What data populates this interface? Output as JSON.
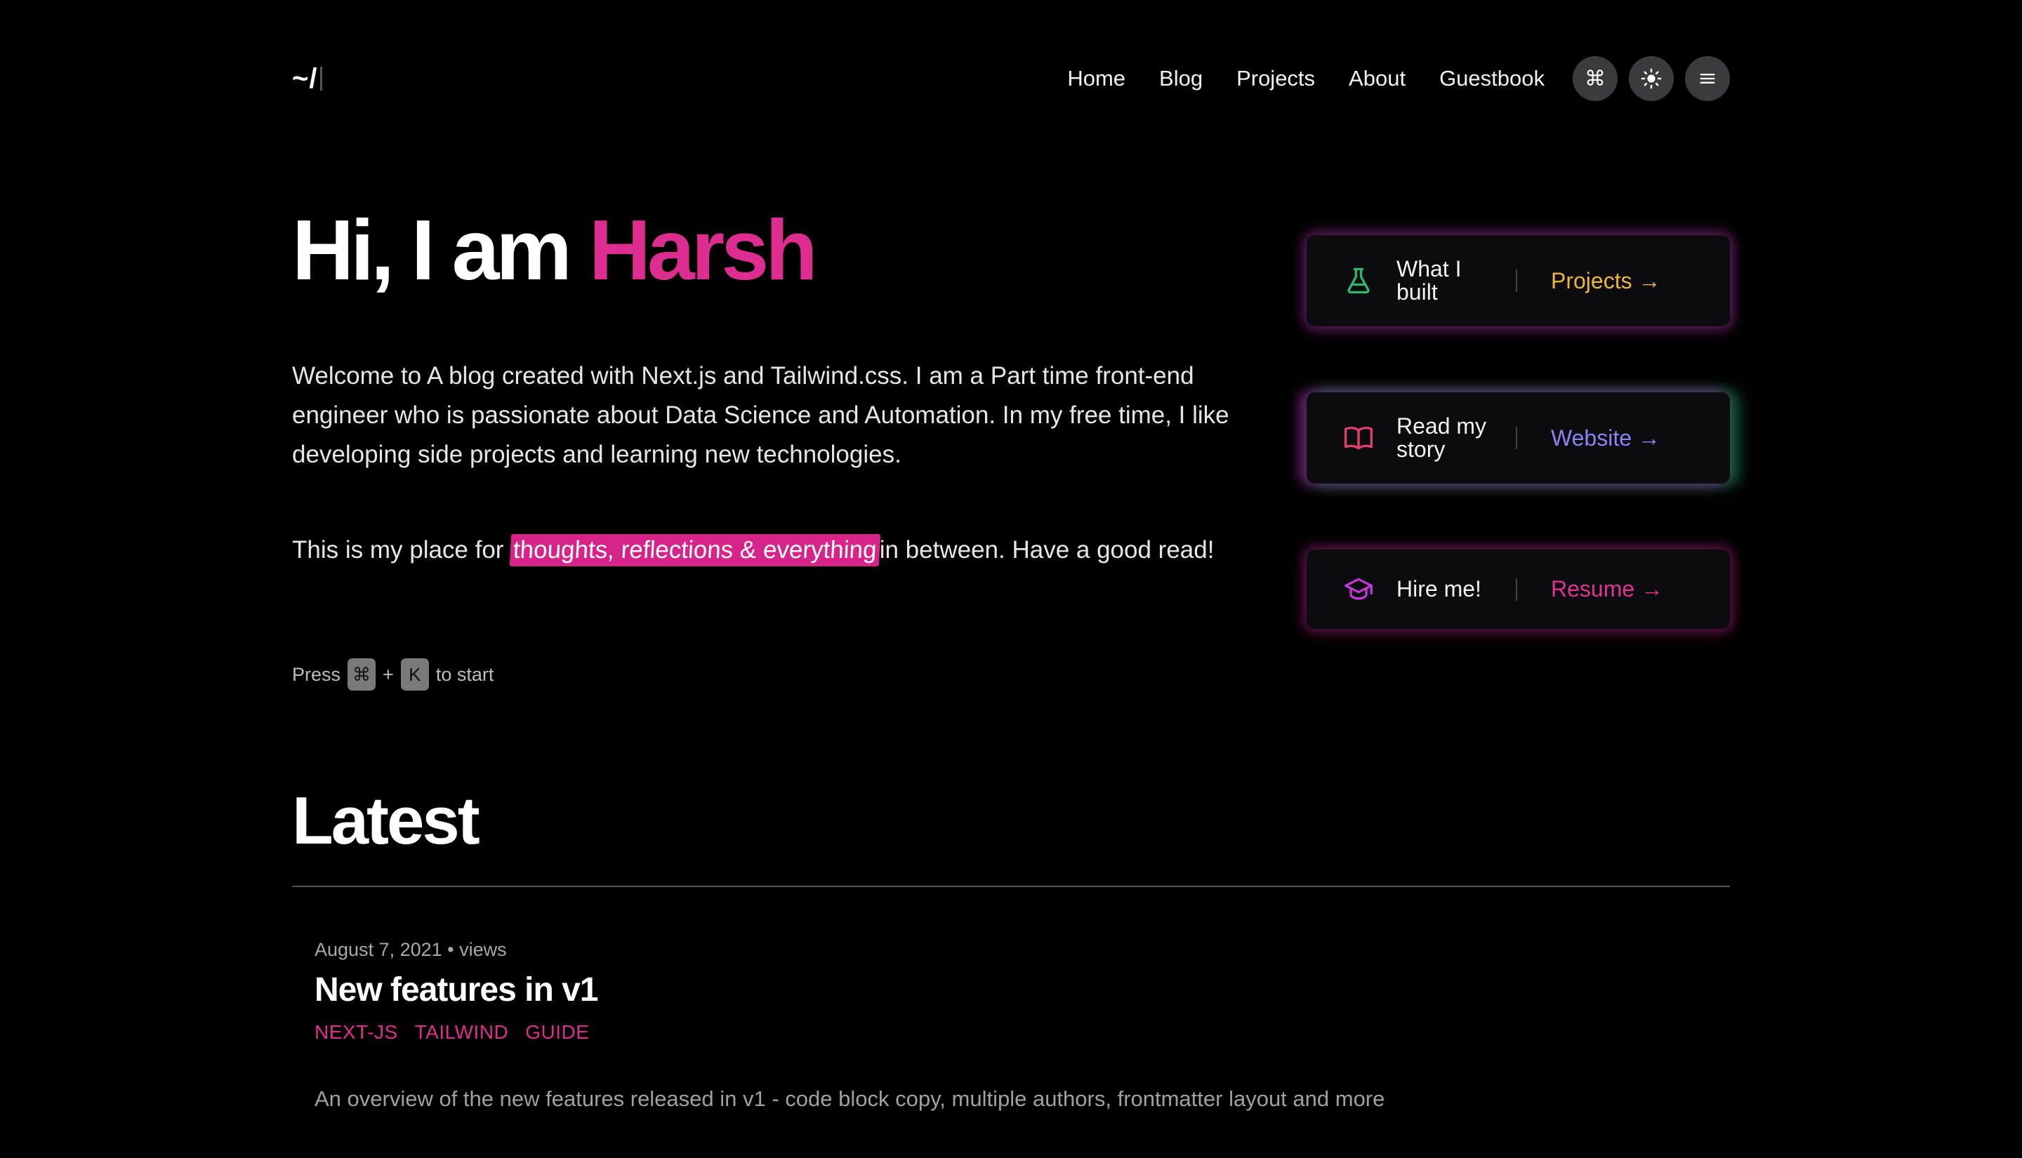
{
  "header": {
    "logo": "~/",
    "nav": [
      "Home",
      "Blog",
      "Projects",
      "About",
      "Guestbook"
    ],
    "buttons": [
      {
        "icon": "command-icon",
        "glyph": "⌘"
      },
      {
        "icon": "sun-icon",
        "glyph": "☀"
      },
      {
        "icon": "menu-icon",
        "glyph": "≡"
      }
    ]
  },
  "hero": {
    "greeting": "Hi, I am ",
    "name": "Harsh",
    "intro": "Welcome to A blog created with Next.js and Tailwind.css. I am a Part time front-end engineer who is passionate about Data Science and Automation. In my free time, I like developing side projects and learning new technologies.",
    "tagline_before": "This is my place for ",
    "tagline_highlight": "thoughts, reflections & everything ",
    "tagline_after": "in between. Have a good read!",
    "press_prefix": "Press",
    "key1": "⌘",
    "plus": "+",
    "key2": "K",
    "press_suffix": "to start"
  },
  "cards": [
    {
      "label": "What I built",
      "link": "Projects →",
      "icon": "flask-icon",
      "color": "#2eb872"
    },
    {
      "label": "Read my story",
      "link": "Website →",
      "icon": "book-icon",
      "color": "#e0406a"
    },
    {
      "label": "Hire me!",
      "link": "Resume →",
      "icon": "graduation-cap-icon",
      "color": "#c23ad6"
    }
  ],
  "latest": {
    "title": "Latest",
    "posts": [
      {
        "date": "August 7, 2021",
        "views": "• views",
        "title": "New features in v1",
        "tags": [
          "NEXT-JS",
          "TAILWIND",
          "GUIDE"
        ],
        "summary": "An overview of the new features released in v1 - code block copy, multiple authors, frontmatter layout and more"
      }
    ]
  },
  "colors": {
    "accent": "#de2d91",
    "background": "#000000"
  }
}
